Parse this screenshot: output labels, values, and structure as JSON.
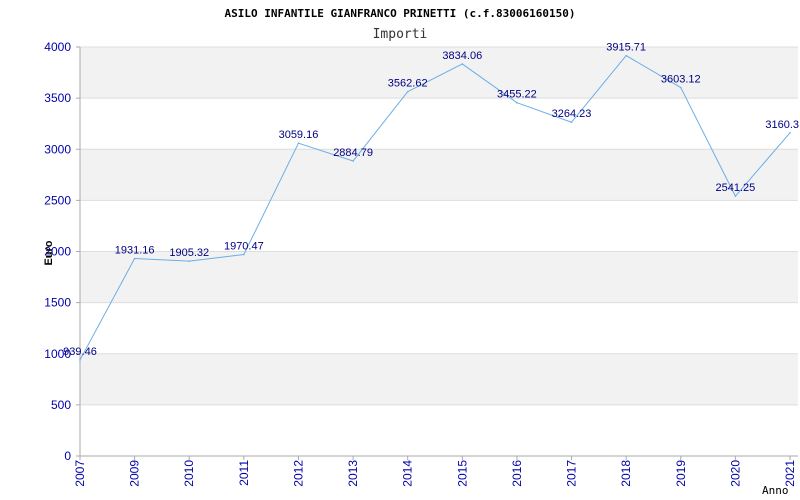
{
  "chart_data": {
    "type": "line",
    "title": "ASILO INFANTILE GIANFRANCO PRINETTI (c.f.83006160150)",
    "subtitle": "Importi",
    "xlabel": "Anno",
    "ylabel": "Euro",
    "categories": [
      "2007",
      "2009",
      "2010",
      "2011",
      "2012",
      "2013",
      "2014",
      "2015",
      "2016",
      "2017",
      "2018",
      "2019",
      "2020",
      "2021"
    ],
    "values": [
      939.46,
      1931.16,
      1905.32,
      1970.47,
      3059.16,
      2884.79,
      3562.62,
      3834.06,
      3455.22,
      3264.23,
      3915.71,
      3603.12,
      2541.25,
      3160.3
    ],
    "ylim": [
      0,
      4000
    ],
    "yticks": [
      0,
      500,
      1000,
      1500,
      2000,
      2500,
      3000,
      3500,
      4000
    ],
    "grid": true,
    "banded_background": true,
    "data_labels_shown": true,
    "markers": false
  },
  "colors": {
    "line": "#6aaee8",
    "data_label": "#000080",
    "tick_label": "#0000aa",
    "band": "#f2f2f2",
    "grid": "#dddddd",
    "axis": "#aaaaaa"
  }
}
